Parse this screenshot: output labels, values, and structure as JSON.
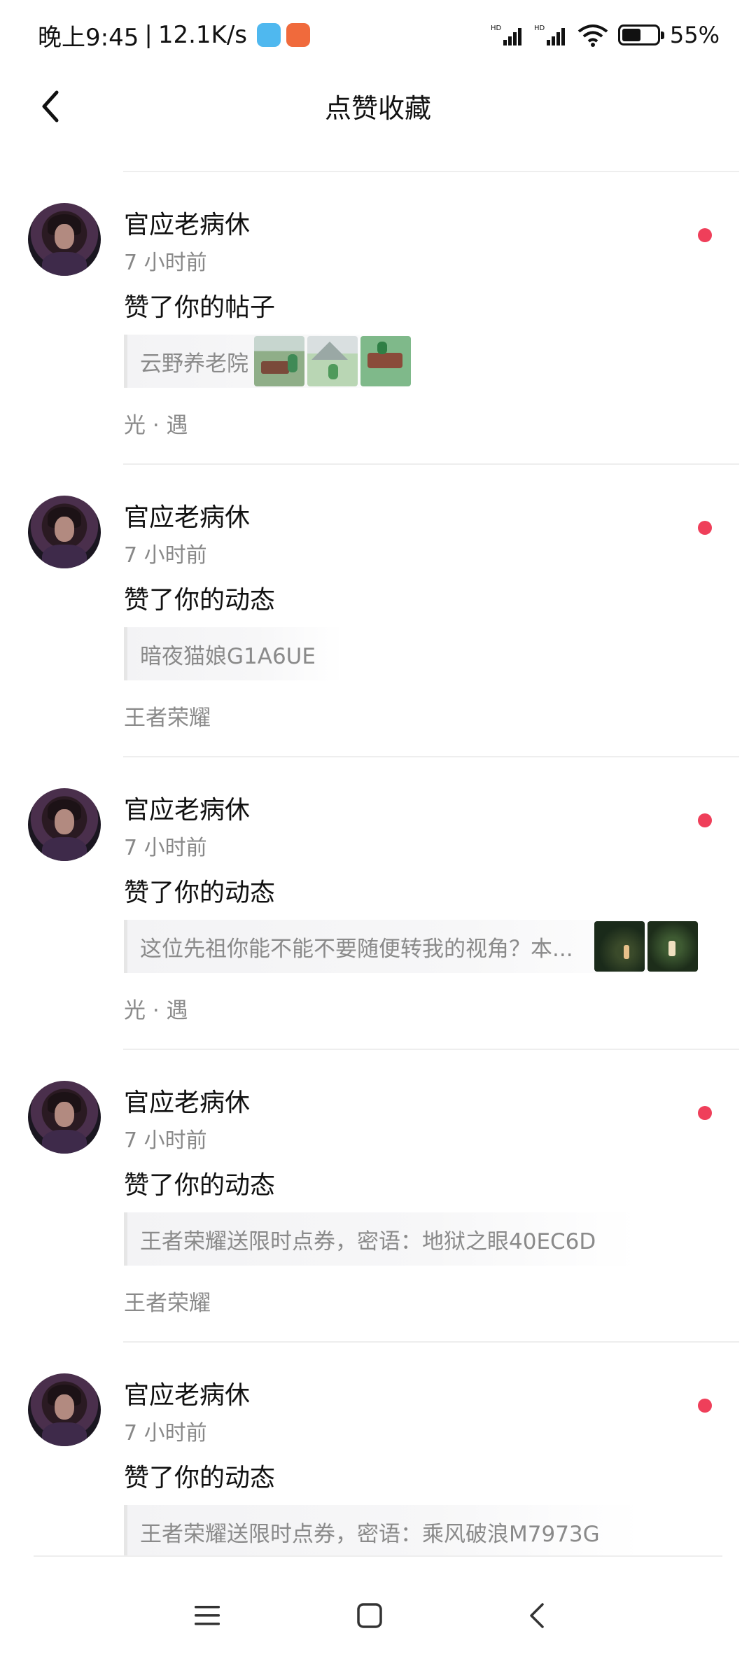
{
  "status_bar": {
    "time": "晚上9:45",
    "separator": "|",
    "network_speed": "12.1K/s",
    "battery_percent": "55%",
    "battery_level": 0.55,
    "icons": [
      "hd-signal-icon",
      "hd-signal-icon",
      "wifi-icon",
      "battery-icon"
    ]
  },
  "header": {
    "title": "点赞收藏",
    "back_icon": "chevron-left-icon"
  },
  "notifications": [
    {
      "username": "官应老病休",
      "time": "7 小时前",
      "action": "赞了你的帖子",
      "quote": "云野养老院",
      "source": "光 · 遇",
      "thumbnails": 3,
      "unread": true
    },
    {
      "username": "官应老病休",
      "time": "7 小时前",
      "action": "赞了你的动态",
      "quote": "暗夜猫娘G1A6UE",
      "source": "王者荣耀",
      "thumbnails": 0,
      "unread": true
    },
    {
      "username": "官应老病休",
      "time": "7 小时前",
      "action": "赞了你的动态",
      "quote": "这位先祖你能不能不要随便转我的视角？本...",
      "source": "光 · 遇",
      "thumbnails": 2,
      "unread": true
    },
    {
      "username": "官应老病休",
      "time": "7 小时前",
      "action": "赞了你的动态",
      "quote": "王者荣耀送限时点券，密语：地狱之眼40EC6D",
      "source": "王者荣耀",
      "thumbnails": 0,
      "unread": true
    },
    {
      "username": "官应老病休",
      "time": "7 小时前",
      "action": "赞了你的动态",
      "quote": "王者荣耀送限时点券，密语：乘风破浪M7973G",
      "source": "",
      "thumbnails": 0,
      "unread": true
    }
  ],
  "nav_bar": {
    "icons": [
      "menu-icon",
      "home-square-icon",
      "back-triangle-icon"
    ]
  },
  "colors": {
    "unread_dot": "#ef3f5a",
    "secondary_text": "#8a8a8a",
    "primary_text": "#111111"
  }
}
